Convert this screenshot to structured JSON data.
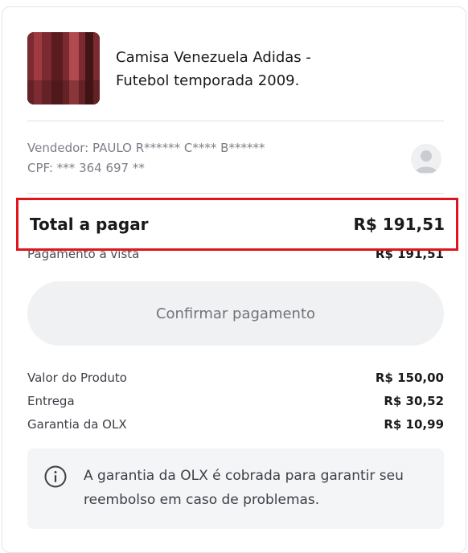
{
  "product": {
    "title": "Camisa Venezuela Adidas - Futebol temporada 2009."
  },
  "seller": {
    "name_line": "Vendedor: PAULO R****** C**** B******",
    "cpf_line": "CPF: *** 364 697 **"
  },
  "total": {
    "label": "Total a pagar",
    "value": "R$ 191,51"
  },
  "payment": {
    "label": "Pagamento à vista",
    "value": "R$ 191,51"
  },
  "confirm_button": {
    "label": "Confirmar pagamento"
  },
  "breakdown": [
    {
      "label": "Valor do Produto",
      "value": "R$ 150,00"
    },
    {
      "label": "Entrega",
      "value": "R$ 30,52"
    },
    {
      "label": "Garantia da OLX",
      "value": "R$ 10,99"
    }
  ],
  "notice": {
    "icon": "info-icon",
    "text": "A garantia da OLX é cobrada para garantir seu reembolso em caso de problemas."
  },
  "colors": {
    "highlight_border": "#e0141c",
    "button_bg": "#eff1f3",
    "muted_text": "#7b7f85"
  }
}
